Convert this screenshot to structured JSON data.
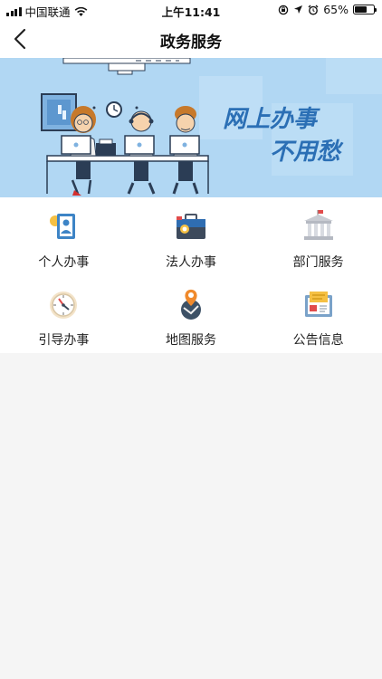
{
  "status_bar": {
    "carrier": "中国联通",
    "time": "上午11:41",
    "battery": "65%",
    "battery_level": 0.65,
    "icons": [
      "signal-icon",
      "wifi-icon",
      "orientation-lock-icon",
      "location-icon",
      "alarm-icon",
      "battery-icon"
    ]
  },
  "nav": {
    "title": "政务服务",
    "back_icon": "chevron-left-icon"
  },
  "banner": {
    "line1": "网上办事",
    "line2": "不用愁",
    "colors": {
      "bg": "#a9d3f2",
      "accent": "#2b6fb5"
    }
  },
  "services": [
    {
      "label": "个人办事",
      "icon": "personal-id-card-icon"
    },
    {
      "label": "法人办事",
      "icon": "briefcase-icon"
    },
    {
      "label": "部门服务",
      "icon": "government-building-icon"
    },
    {
      "label": "引导办事",
      "icon": "compass-icon"
    },
    {
      "label": "地图服务",
      "icon": "map-pin-icon"
    },
    {
      "label": "公告信息",
      "icon": "notice-board-icon"
    }
  ]
}
